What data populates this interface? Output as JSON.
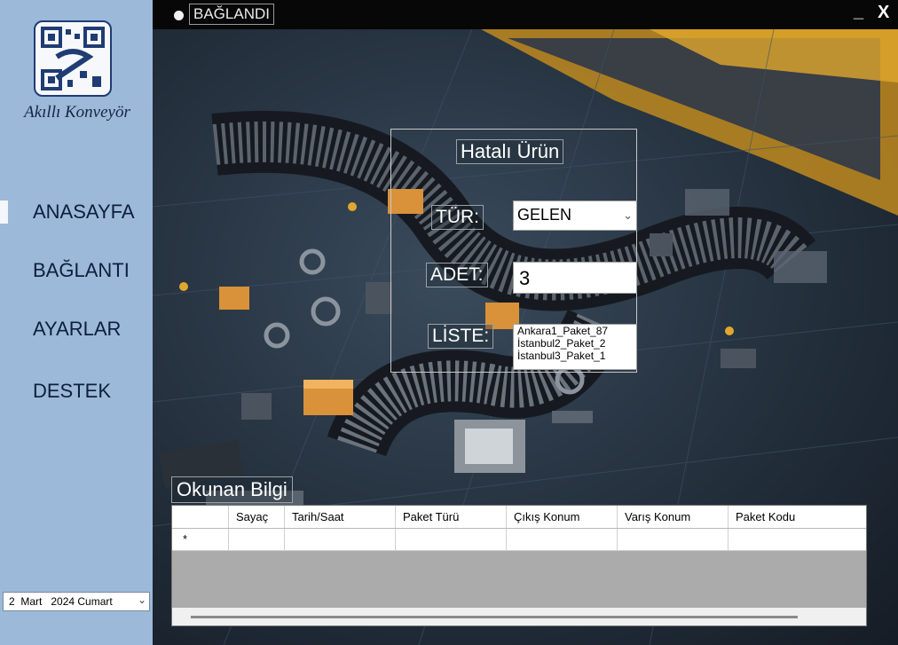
{
  "app": {
    "brand": "Akıllı Konveyör",
    "logo_icon": "qr-conveyor-logo-icon"
  },
  "titlebar": {
    "status_text": "BAĞLANDI",
    "status_icon": "status-dot-icon",
    "minimize_label": "_",
    "close_label": "X"
  },
  "sidebar": {
    "items": [
      {
        "label": "ANASAYFA",
        "active": true
      },
      {
        "label": "BAĞLANTI",
        "active": false
      },
      {
        "label": "AYARLAR",
        "active": false
      },
      {
        "label": "DESTEK",
        "active": false
      }
    ],
    "date_picker": {
      "value": "2  Mart   2024 Cumart",
      "icon": "chevron-down-icon"
    }
  },
  "hatali_urun": {
    "title": "Hatalı Ürün",
    "tur_label": "TÜR:",
    "tur_value": "GELEN",
    "tur_icon": "chevron-down-icon",
    "adet_label": "ADET:",
    "adet_value": "3",
    "liste_label": "LİSTE:",
    "liste_items": [
      "Ankara1_Paket_87",
      "İstanbul2_Paket_2",
      "İstanbul3_Paket_1"
    ]
  },
  "okunan_bilgi": {
    "title": "Okunan Bilgi",
    "columns": [
      "",
      "Sayaç",
      "Tarih/Saat",
      "Paket Türü",
      "Çıkış Konum",
      "Varış Konum",
      "Paket Kodu"
    ],
    "new_row_marker": "*"
  },
  "colors": {
    "sidebar_bg": "#9cb9da",
    "titlebar_bg": "#070707",
    "grid_bg": "#ababab"
  }
}
